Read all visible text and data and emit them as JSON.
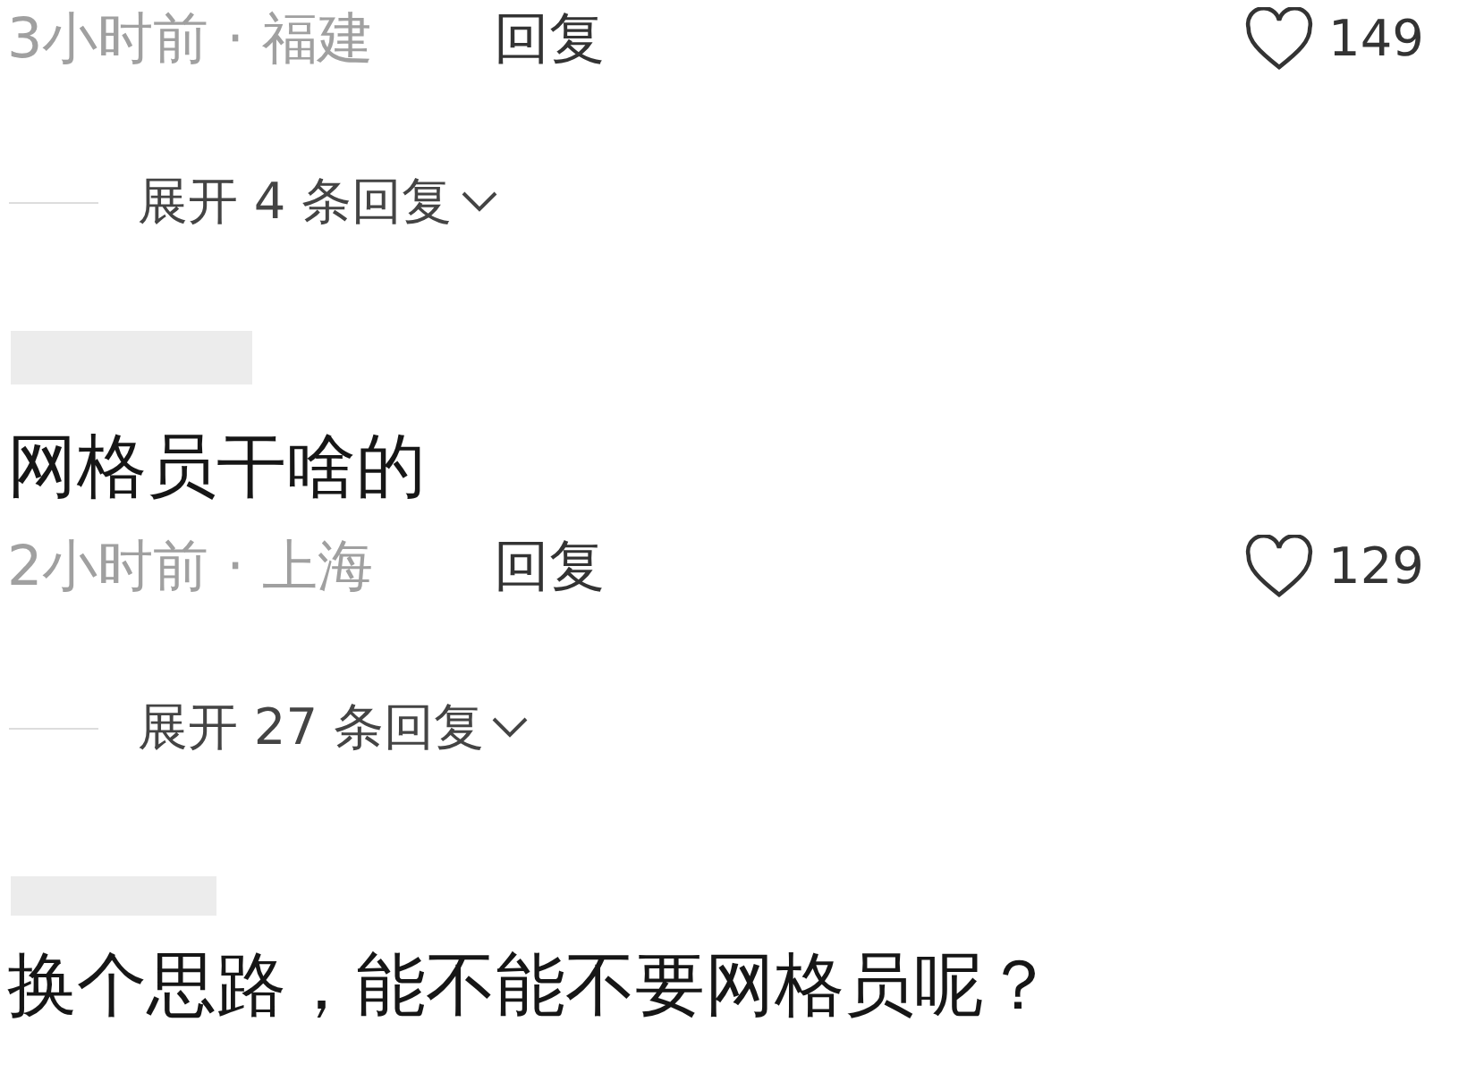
{
  "comments": [
    {
      "meta": {
        "time_location": "3小时前 · 福建",
        "reply": "回复",
        "likes": "149"
      },
      "expand": "展开 4 条回复"
    },
    {
      "username_hidden": true,
      "text": "网格员干啥的",
      "meta": {
        "time_location": "2小时前 · 上海",
        "reply": "回复",
        "likes": "129"
      },
      "expand": "展开 27 条回复"
    },
    {
      "username_hidden": true,
      "text": "换个思路，能不能不要网格员呢？"
    }
  ]
}
